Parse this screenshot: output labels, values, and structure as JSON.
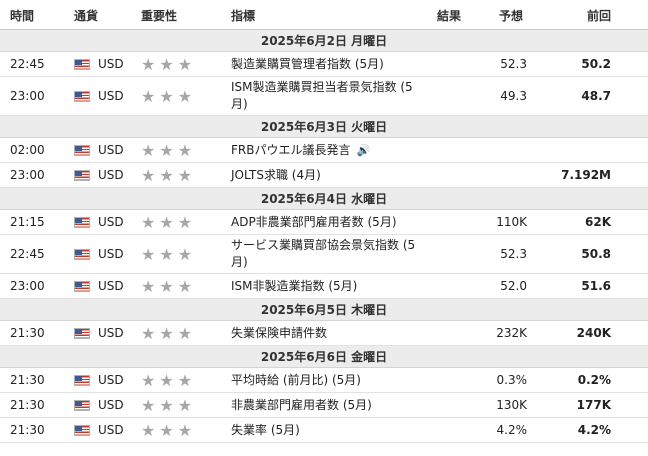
{
  "headers": {
    "time": "時間",
    "currency": "通貨",
    "importance": "重要性",
    "indicator": "指標",
    "result": "結果",
    "forecast": "予想",
    "previous": "前回"
  },
  "icons": {
    "flag": "us-flag-icon",
    "star": "star-icon",
    "speaker": "speaker-icon"
  },
  "days": [
    {
      "date": "2025年6月2日 月曜日",
      "events": [
        {
          "time": "22:45",
          "currency": "USD",
          "stars": "★★★",
          "indicator": "製造業購買管理者指数 (5月)",
          "forecast": "52.3",
          "previous": "50.2"
        },
        {
          "time": "23:00",
          "currency": "USD",
          "stars": "★★★",
          "indicator": "ISM製造業購買担当者景気指数 (5月)",
          "forecast": "49.3",
          "previous": "48.7"
        }
      ]
    },
    {
      "date": "2025年6月3日 火曜日",
      "events": [
        {
          "time": "02:00",
          "currency": "USD",
          "stars": "★★★",
          "indicator": "FRBパウエル議長発言",
          "forecast": "",
          "previous": "",
          "speaker": "🔊"
        },
        {
          "time": "23:00",
          "currency": "USD",
          "stars": "★★★",
          "indicator": "JOLTS求職 (4月)",
          "forecast": "",
          "previous": "7.192M"
        }
      ]
    },
    {
      "date": "2025年6月4日 水曜日",
      "events": [
        {
          "time": "21:15",
          "currency": "USD",
          "stars": "★★★",
          "indicator": "ADP非農業部門雇用者数 (5月)",
          "forecast": "110K",
          "previous": "62K"
        },
        {
          "time": "22:45",
          "currency": "USD",
          "stars": "★★★",
          "indicator": "サービス業購買部協会景気指数 (5月)",
          "forecast": "52.3",
          "previous": "50.8"
        },
        {
          "time": "23:00",
          "currency": "USD",
          "stars": "★★★",
          "indicator": "ISM非製造業指数 (5月)",
          "forecast": "52.0",
          "previous": "51.6"
        }
      ]
    },
    {
      "date": "2025年6月5日 木曜日",
      "events": [
        {
          "time": "21:30",
          "currency": "USD",
          "stars": "★★★",
          "indicator": "失業保険申請件数",
          "forecast": "232K",
          "previous": "240K"
        }
      ]
    },
    {
      "date": "2025年6月6日 金曜日",
      "events": [
        {
          "time": "21:30",
          "currency": "USD",
          "stars": "★★★",
          "indicator": "平均時給 (前月比) (5月)",
          "forecast": "0.3%",
          "previous": "0.2%"
        },
        {
          "time": "21:30",
          "currency": "USD",
          "stars": "★★★",
          "indicator": "非農業部門雇用者数 (5月)",
          "forecast": "130K",
          "previous": "177K"
        },
        {
          "time": "21:30",
          "currency": "USD",
          "stars": "★★★",
          "indicator": "失業率 (5月)",
          "forecast": "4.2%",
          "previous": "4.2%"
        }
      ]
    }
  ]
}
